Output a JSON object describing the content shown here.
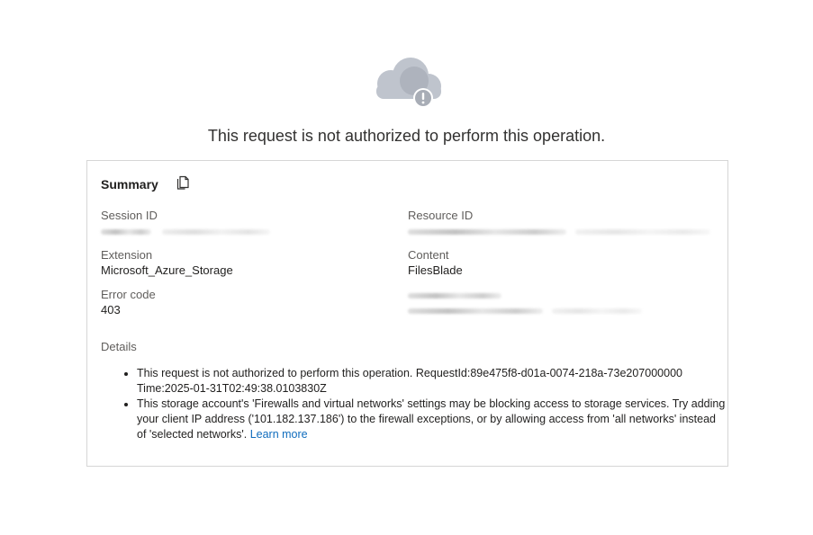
{
  "headline": "This request is not authorized to perform this operation.",
  "summary": {
    "title": "Summary",
    "copy_icon": "copy-icon"
  },
  "fields": {
    "session_id": {
      "label": "Session ID"
    },
    "resource_id": {
      "label": "Resource ID"
    },
    "extension": {
      "label": "Extension",
      "value": "Microsoft_Azure_Storage"
    },
    "content": {
      "label": "Content",
      "value": "FilesBlade"
    },
    "error_code": {
      "label": "Error code",
      "value": "403"
    }
  },
  "details": {
    "label": "Details",
    "item1": "This request is not authorized to perform this operation. RequestId:89e475f8-d01a-0074-218a-73e207000000 Time:2025-01-31T02:49:38.0103830Z",
    "item2": "This storage account's 'Firewalls and virtual networks' settings may be blocking access to storage services. Try adding your client IP address ('101.182.137.186') to the firewall exceptions, or by allowing access from 'all networks' instead of 'selected networks'.",
    "learn_more": "Learn more"
  },
  "colors": {
    "link": "#0f6cbd",
    "cloud": "#b7bcc6",
    "alert_badge": "#a8adb6"
  }
}
